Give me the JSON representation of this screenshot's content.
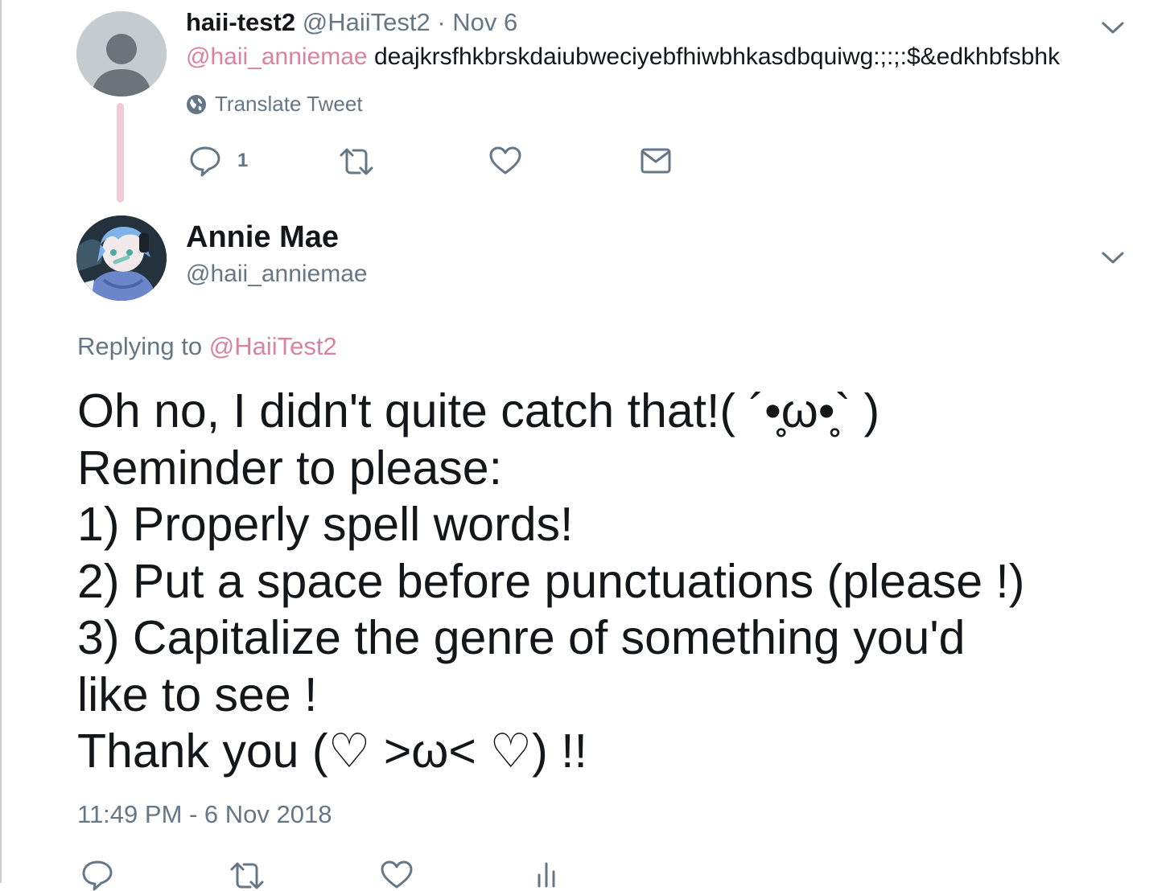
{
  "parent_tweet": {
    "display_name": "haii-test2",
    "handle": "@HaiiTest2",
    "separator": "·",
    "date": "Nov 6",
    "mention": "@haii_anniemae",
    "text": "deajkrsfhkbrskdaiubweciyebfhiwbhkasdbquiwg:;:;:$&edkhbfsbhk",
    "translate_label": "Translate Tweet",
    "reply_count": "1",
    "icons": [
      "globe-icon",
      "reply-icon",
      "retweet-icon",
      "like-icon",
      "message-icon",
      "chevron-down-icon"
    ]
  },
  "main_tweet": {
    "display_name": "Annie Mae",
    "handle": "@haii_anniemae",
    "replying_prefix": "Replying to",
    "replying_to": "@HaiiTest2",
    "lines": [
      "Oh no, I didn't quite catch that!( ´•̥ω•̥` )",
      "Reminder to please:",
      "1) Properly spell words!",
      "2) Put a space before punctuations (please !)",
      "3) Capitalize the genre of something you'd",
      "like to see !",
      "Thank you (♡ >ω< ♡) !!"
    ],
    "timestamp": "11:49 PM - 6 Nov 2018",
    "icons": [
      "reply-icon",
      "retweet-icon",
      "like-icon",
      "analytics-icon",
      "chevron-down-icon"
    ]
  },
  "colors": {
    "accent": "#d9839f",
    "muted": "#657786",
    "thread_line": "#f2c9d6",
    "text": "#14171a"
  }
}
